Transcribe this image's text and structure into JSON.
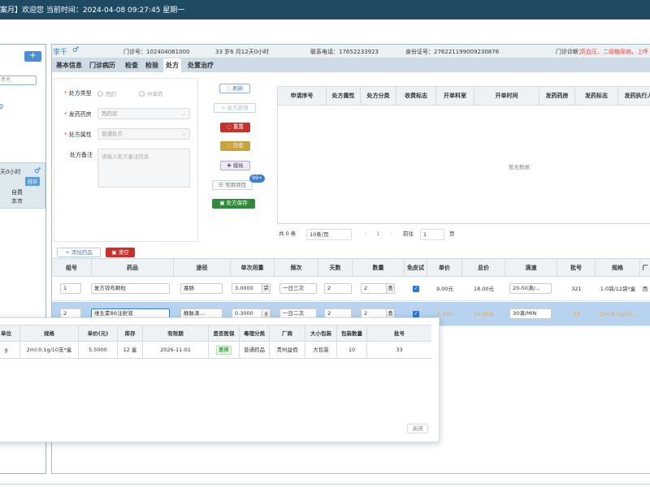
{
  "topbar": {
    "text": "案月】欢迎您  当前时间：2024-04-08 09:27:45 星期一"
  },
  "left": {
    "plus": "+",
    "search_placeholder": "患者",
    "count": "0",
    "card": {
      "time": "天0小时",
      "gender_icon": "♂",
      "badge": "轻诊",
      "l1": "自费",
      "l2": "本市"
    }
  },
  "patient": {
    "name": "李千",
    "gender_icon": "♂",
    "clinic_no": "门诊号：102404081000",
    "age": "33 岁6 月12天0小时",
    "phone": "联系电话：17652233923",
    "id_card": "身份证号：276221199009230876",
    "diag_label": "门诊诊断：",
    "diag": "高血压，二级糖尿病，上呼"
  },
  "tabs": [
    "基本信息",
    "门诊病历",
    "检查",
    "检验",
    "处方",
    "处置治疗"
  ],
  "form": {
    "type_label": "处方类型",
    "type_opt1": "西药",
    "type_opt2": "中草药",
    "pharmacy_label": "发药药房",
    "pharmacy_value": "西药房",
    "attr_label": "处方属性",
    "attr_value": "普通处方",
    "note_label": "处方备注",
    "note_placeholder": "请输入处方备注信息"
  },
  "buttons": {
    "refresh": "◌ 刷新",
    "new": "+ 处方新增",
    "reset": "◌ 重置",
    "history": "◌ 历史",
    "template": "✚ 模板",
    "common": "☰ 常用项目",
    "save": "▣ 处方保存",
    "badge": "99+"
  },
  "rx_table": {
    "headers": [
      "申请序号",
      "处方属性",
      "处方分类",
      "收费标志",
      "开单科室",
      "开单时间",
      "发药药房",
      "发药标志",
      "发药执行人"
    ],
    "empty": "暂无数据"
  },
  "pager": {
    "total": "共 0 条",
    "size": "10条/页",
    "prev": "‹",
    "page": "1",
    "next": "›",
    "goto": "前往",
    "goto_val": "1",
    "page_unit": "页"
  },
  "add_drug": "+ 添加药品",
  "clear": "▣ 清空",
  "drug_table": {
    "headers": [
      "组号",
      "药品",
      "途径",
      "单次用量",
      "频次",
      "天数",
      "数量",
      "免皮试",
      "单价",
      "总价",
      "滴速",
      "批号",
      "规格",
      "厂"
    ],
    "rows": [
      {
        "group": "1",
        "drug": "复方锌布颗粒",
        "route": "塞肠",
        "dose": "3.0000",
        "dose_unit": "袋",
        "freq": "一日三次",
        "days": "2",
        "qty": "2",
        "qty_unit": "盒",
        "price": "9.00元",
        "total": "18.00元",
        "speed": "20-50滴/...",
        "batch": "321",
        "spec": "1.0袋/12袋*盒",
        "mfr": "西"
      },
      {
        "group": "2",
        "drug": "维生素B6注射液",
        "route": "静脉滴...",
        "dose": "0.3000",
        "dose_unit": "g",
        "freq": "一日二次",
        "days": "2",
        "qty": "2",
        "qty_unit": "盒",
        "price": "5.500",
        "total": "11.00元",
        "speed": "30滴/MIN",
        "batch": "33",
        "spec": "2ml:0.1g/10...",
        "mfr": ""
      }
    ]
  },
  "popup": {
    "headers": [
      "单位",
      "规格",
      "单价(元)",
      "库存",
      "有效期",
      "是否医保",
      "毒理分类",
      "厂商",
      "大小包装",
      "包装数量",
      "批号"
    ],
    "row": {
      "unit": "g",
      "spec": "2ml:0.1g/10支*盒",
      "price": "5.5000",
      "stock": "12 盒",
      "expiry": "2026-11-01",
      "insured": "医保",
      "toxic": "普通药品",
      "mfr": "贵州益佰",
      "pack": "大包装",
      "pack_qty": "10",
      "batch": "33"
    },
    "close": "关闭"
  },
  "colors": {
    "topbar": "#1f4a63",
    "accent": "#3a7fd4",
    "danger": "#c8302b",
    "highlight_row": "#b7d3ef"
  }
}
